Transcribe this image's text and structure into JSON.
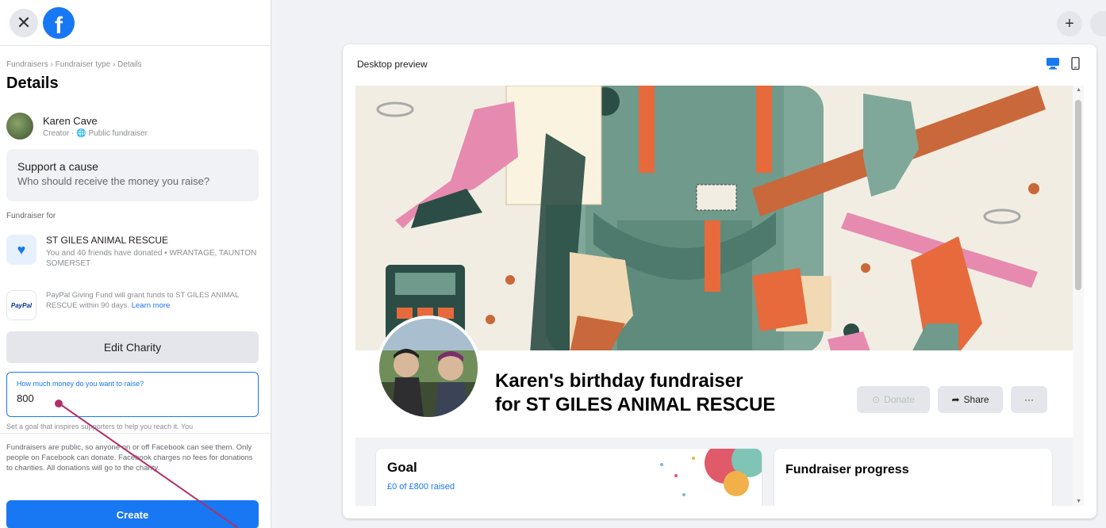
{
  "sidebar": {
    "breadcrumb": "Fundraisers › Fundraiser type › Details",
    "title": "Details",
    "creator": {
      "name": "Karen Cave",
      "sub": "Creator · 🌐 Public fundraiser"
    },
    "cause": {
      "title": "Support a cause",
      "subtitle": "Who should receive the money you raise?"
    },
    "fundraiser_for_label": "Fundraiser for",
    "charity": {
      "name": "ST GILES ANIMAL RESCUE",
      "sub": "You and 40 friends have donated • WRANTAGE, TAUNTON SOMERSET"
    },
    "paypal": {
      "logo": "PayPal",
      "text": "PayPal Giving Fund will grant funds to ST GILES ANIMAL RESCUE within 90 days.",
      "link": "Learn more"
    },
    "edit_charity": "Edit Charity",
    "goal_field": {
      "label": "How much money do you want to raise?",
      "value": "800"
    },
    "goal_help": "Set a goal that inspires supporters to help you reach it. You",
    "footer_note": "Fundraisers are public, so anyone on or off Facebook can see them. Only people on Facebook can donate. Facebook charges no fees for donations to charities. All donations will go to the charity.",
    "create_label": "Create"
  },
  "preview": {
    "header": "Desktop preview",
    "fundraiser_title_line1": "Karen's birthday fundraiser",
    "fundraiser_title_line2": "for ST GILES ANIMAL RESCUE",
    "donate": "Donate",
    "share": "Share",
    "more": "···",
    "goal_title": "Goal",
    "goal_sub": "£0 of £800 raised",
    "progress_title": "Fundraiser progress"
  },
  "icons": {
    "close": "close-icon",
    "facebook": "facebook-logo",
    "plus": "plus-icon",
    "desktop": "desktop-icon",
    "mobile": "mobile-icon"
  },
  "colors": {
    "brand": "#1877f2",
    "annotation_arrow": "#b0306a"
  }
}
